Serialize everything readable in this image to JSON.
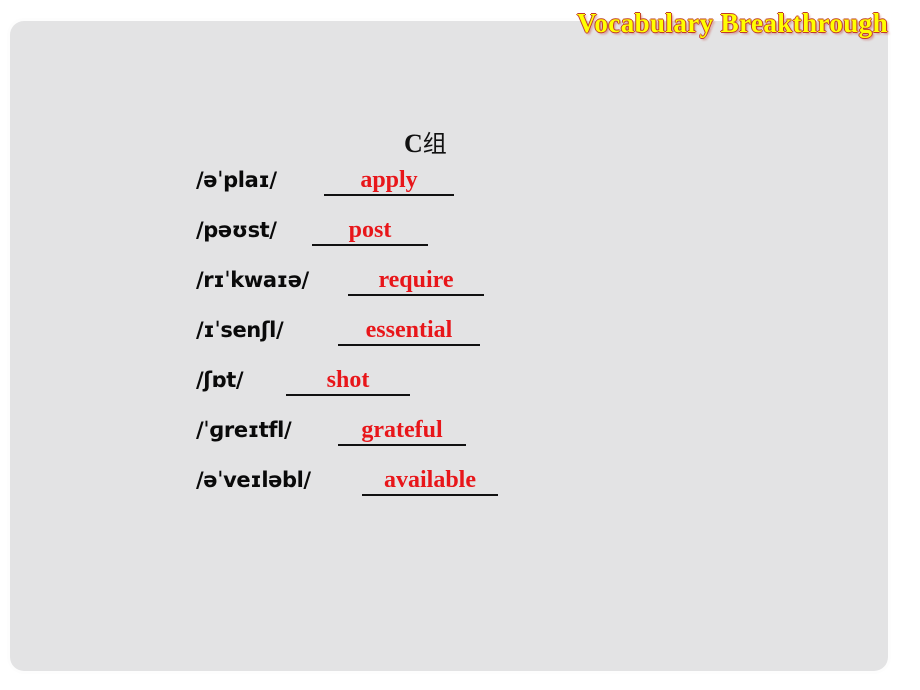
{
  "slide": {
    "title": "Vocabulary Breakthrough",
    "group_heading_letter": "C",
    "group_heading_cn": "组",
    "colors": {
      "title_text": "#ffff00",
      "title_shadow": "#c0392b",
      "answer_text": "#e8161a",
      "phonetic_text": "#0a0a0a",
      "panel_background": "#e3e3e4",
      "slide_background": "#ffffff"
    }
  },
  "vocab": {
    "rows": [
      {
        "phonetic": "/əˈplaɪ/",
        "answer": "apply"
      },
      {
        "phonetic": "/pəʊst/",
        "answer": "post"
      },
      {
        "phonetic": "/rɪˈkwaɪə/",
        "answer": "require"
      },
      {
        "phonetic": "/ɪˈsenʃl/",
        "answer": "essential"
      },
      {
        "phonetic": "/ʃɒt/",
        "answer": "shot"
      },
      {
        "phonetic": "/ˈɡreɪtfl/",
        "answer": "grateful"
      },
      {
        "phonetic": "/əˈveɪləbl/",
        "answer": "available"
      }
    ]
  }
}
